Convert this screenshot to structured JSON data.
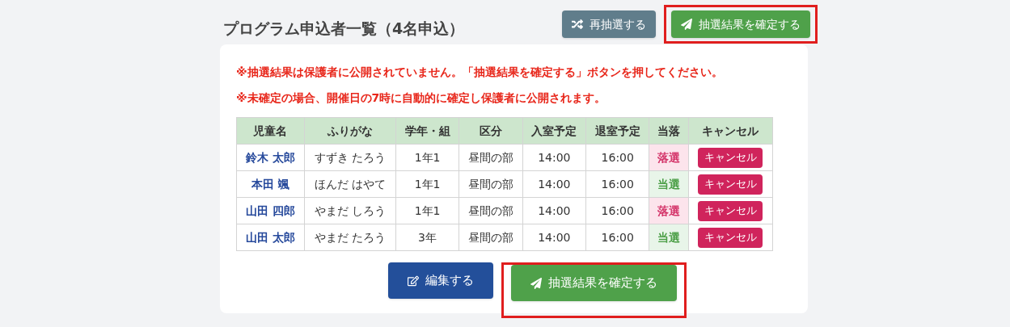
{
  "title": "プログラム申込者一覧（4名申込）",
  "top_buttons": [
    {
      "kind": "shuffle",
      "label": "再抽選する",
      "highlighted": false
    },
    {
      "kind": "confirm",
      "label": "抽選結果を確定する",
      "highlighted": true
    }
  ],
  "notices": [
    "※抽選結果は保護者に公開されていません。「抽選結果を確定する」ボタンを押してください。",
    "※未確定の場合、開催日の7時に自動的に確定し保護者に公開されます。"
  ],
  "table": {
    "columns": [
      "児童名",
      "ふりがな",
      "学年・組",
      "区分",
      "入室予定",
      "退室予定",
      "当落",
      "キャンセル"
    ],
    "rows": [
      {
        "name": "鈴木 太郎",
        "kana": "すずき たろう",
        "grade": "1年1",
        "section": "昼間の部",
        "in": "14:00",
        "out": "16:00",
        "result": "落選",
        "kind": "lost",
        "cancel": "キャンセル"
      },
      {
        "name": "本田 颯",
        "kana": "ほんだ はやて",
        "grade": "1年1",
        "section": "昼間の部",
        "in": "14:00",
        "out": "16:00",
        "result": "当選",
        "kind": "won",
        "cancel": "キャンセル"
      },
      {
        "name": "山田 四郎",
        "kana": "やまだ しろう",
        "grade": "1年1",
        "section": "昼間の部",
        "in": "14:00",
        "out": "16:00",
        "result": "落選",
        "kind": "lost",
        "cancel": "キャンセル"
      },
      {
        "name": "山田 太郎",
        "kana": "やまだ たろう",
        "grade": "3年",
        "section": "昼間の部",
        "in": "14:00",
        "out": "16:00",
        "result": "当選",
        "kind": "won",
        "cancel": "キャンセル"
      }
    ]
  },
  "bottom_buttons": [
    {
      "kind": "edit",
      "label": "編集する",
      "highlighted": false
    },
    {
      "kind": "confirm",
      "label": "抽選結果を確定する",
      "highlighted": true
    }
  ]
}
